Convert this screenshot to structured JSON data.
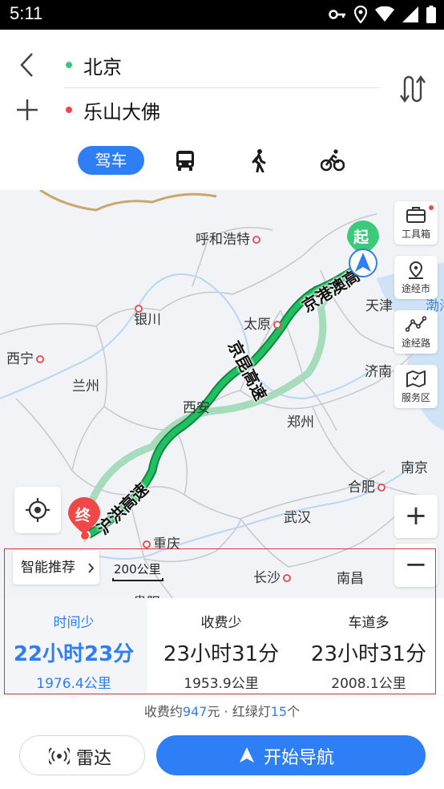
{
  "status": {
    "time": "5:11"
  },
  "search": {
    "start": "北京",
    "end": "乐山大佛"
  },
  "modes": {
    "active_label": "驾车",
    "others": [
      "bus-icon",
      "walk-icon",
      "bike-icon"
    ]
  },
  "map": {
    "cities": {
      "hohhot": "呼和浩特",
      "yinchuan": "银川",
      "taiyuan": "太原",
      "tianjin": "天津",
      "bohai": "渤海",
      "xining": "西宁",
      "lanzhou": "兰州",
      "jinan": "济南",
      "xian": "西安",
      "zhengzhou": "郑州",
      "nanjing": "南京",
      "hefei": "合肥",
      "wuhan": "武汉",
      "chongqing": "重庆",
      "changsha": "长沙",
      "nanchang": "南昌",
      "guiyang": "贵阳"
    },
    "roads": {
      "jinggang": "京港澳高",
      "jingkun": "京昆高速",
      "huhong": "沪洪高速"
    },
    "start_marker": "起",
    "end_marker": "终",
    "tools": {
      "toolbox": "工具箱",
      "via_city": "途经市",
      "via_road": "途经路",
      "service": "服务区"
    },
    "smart_recommend": "智能推荐",
    "scale": "200公里"
  },
  "routes": [
    {
      "name": "时间少",
      "time": "22小时23分",
      "distance": "1976.4公里"
    },
    {
      "name": "收费少",
      "time": "23小时31分",
      "distance": "1953.9公里"
    },
    {
      "name": "车道多",
      "time": "23小时31分",
      "distance": "2008.1公里"
    }
  ],
  "footer": {
    "prefix": "收费约",
    "toll": "947",
    "mid": "元 · 红绿灯",
    "lights": "15",
    "suffix": "个"
  },
  "buttons": {
    "radar": "雷达",
    "navigate": "开始导航"
  },
  "colors": {
    "accent": "#2e7ef5",
    "route_primary": "#19b35a",
    "route_alt": "#a6dcbc",
    "start": "#3bc97b",
    "end": "#f04848"
  }
}
